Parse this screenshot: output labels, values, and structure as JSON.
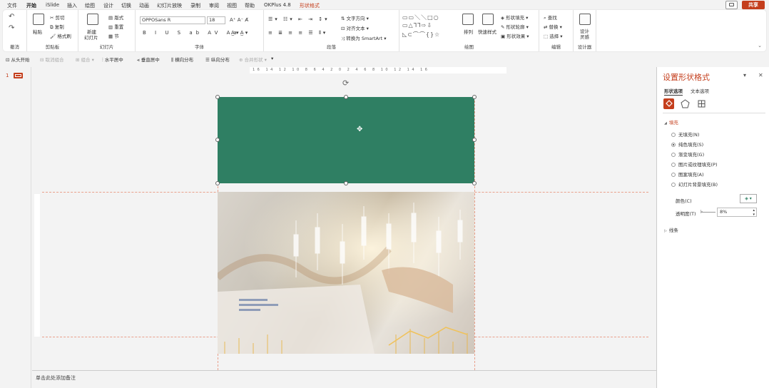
{
  "menu": {
    "tabs": [
      {
        "label": "文件"
      },
      {
        "label": "开始"
      },
      {
        "label": "iSlide"
      },
      {
        "label": "插入"
      },
      {
        "label": "绘图"
      },
      {
        "label": "设计"
      },
      {
        "label": "切换"
      },
      {
        "label": "动画"
      },
      {
        "label": "幻灯片放映"
      },
      {
        "label": "录制"
      },
      {
        "label": "审阅"
      },
      {
        "label": "视图"
      },
      {
        "label": "帮助"
      },
      {
        "label": "OKPlus 4.8"
      },
      {
        "label": "形状格式"
      }
    ],
    "share_label": "共享"
  },
  "ribbon": {
    "undo": {
      "label": "撤消"
    },
    "clipboard": {
      "paste": "粘贴",
      "cut": "剪切",
      "copy": "复制",
      "format_painter": "格式刷",
      "label": "剪贴板"
    },
    "slides": {
      "new_slide": "新建",
      "new_slide2": "幻灯片",
      "layout": "版式",
      "reset": "重置",
      "section": "节",
      "label": "幻灯片"
    },
    "font": {
      "name": "OPPOSans R",
      "size": "18",
      "label": "字体"
    },
    "paragraph": {
      "text_direction": "文字方向",
      "align_text": "对齐文本",
      "smartart": "转换为 SmartArt",
      "label": "段落"
    },
    "drawing": {
      "arrange": "排列",
      "quick_styles": "快速样式",
      "shape_fill": "形状填充",
      "shape_outline": "形状轮廓",
      "shape_effects": "形状效果",
      "label": "绘图"
    },
    "editing": {
      "find": "查找",
      "replace": "替换",
      "select": "选择",
      "label": "编辑"
    },
    "designer": {
      "ideas1": "设计",
      "ideas2": "灵感",
      "label": "设计器"
    }
  },
  "quickbar": {
    "items": [
      {
        "label": "从头开始"
      },
      {
        "label": "取消组合"
      },
      {
        "label": "组合"
      },
      {
        "label": "水平居中"
      },
      {
        "label": "垂直居中"
      },
      {
        "label": "横向分布"
      },
      {
        "label": "纵向分布"
      },
      {
        "label": "合并形状"
      }
    ]
  },
  "thumbnails": {
    "slide_number": "1"
  },
  "ruler": {
    "labels": "16 14 12 10 8 6 4 2 0 2 4 6 8 10 12 14 16"
  },
  "notes": {
    "placeholder": "单击此处添加备注"
  },
  "format_pane": {
    "title": "设置形状格式",
    "tabs": [
      {
        "label": "形状选项"
      },
      {
        "label": "文本选项"
      }
    ],
    "fill_section": "填充",
    "fill_options": [
      {
        "label": "无填充(N)"
      },
      {
        "label": "纯色填充(S)"
      },
      {
        "label": "渐变填充(G)"
      },
      {
        "label": "图片或纹理填充(P)"
      },
      {
        "label": "图案填充(A)"
      },
      {
        "label": "幻灯片背景填充(B)"
      }
    ],
    "selected_fill": 1,
    "color_label": "颜色(C)",
    "transparency_label": "透明度(T)",
    "transparency_value": "8%",
    "line_section": "线条"
  },
  "colors": {
    "accent": "#c43e1c",
    "shape_fill": "#2f7f63"
  }
}
